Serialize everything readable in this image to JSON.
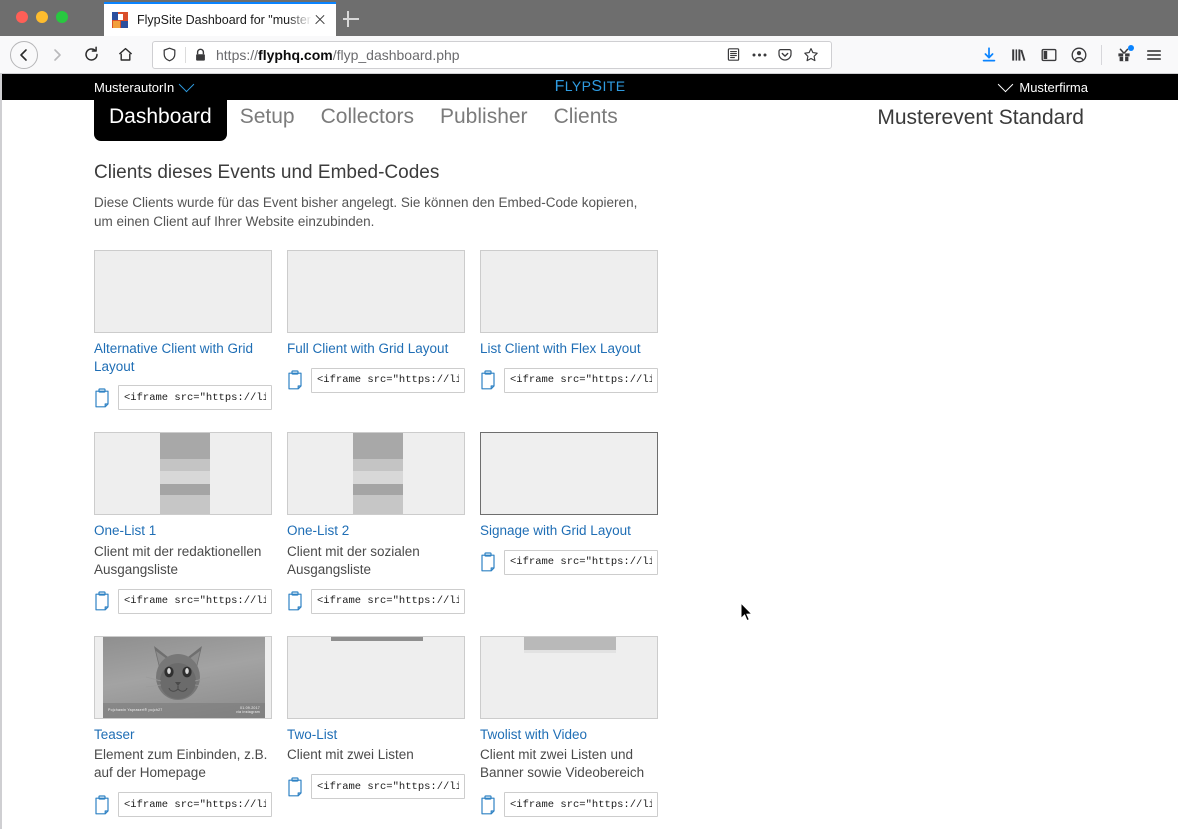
{
  "browser": {
    "tab": {
      "title": "FlypSite Dashboard for \"muster",
      "favicon_name": "flypsite-favicon",
      "close_label": "Close tab"
    },
    "new_tab_label": "New tab",
    "nav": {
      "back": "Back",
      "forward": "Forward",
      "reload": "Reload",
      "home": "Home"
    },
    "url": {
      "scheme": "https://",
      "host": "flyphq.com",
      "path": "/flyp_dashboard.php",
      "shield_icon": "shield-icon",
      "lock_icon": "lock-icon",
      "reader_icon": "reader-view-icon",
      "ellipsis_icon": "page-actions-icon",
      "pocket_icon": "pocket-icon",
      "star_icon": "bookmark-star-icon"
    },
    "toolbar": {
      "download_icon": "download-icon",
      "library_icon": "library-icon",
      "sidebar_icon": "sidebar-icon",
      "account_icon": "account-icon",
      "extensions_icon": "extensions-icon",
      "menu_icon": "hamburger-menu-icon"
    }
  },
  "appbar": {
    "user": "MusterautorIn",
    "brand_caps": "F",
    "brand_rest_1": "LYP",
    "brand_caps_2": "S",
    "brand_rest_2": "ITE",
    "brand_full": "FlypSite",
    "company": "Musterfirma"
  },
  "nav": {
    "tabs": [
      {
        "label": "Dashboard",
        "active": true
      },
      {
        "label": "Setup",
        "active": false
      },
      {
        "label": "Collectors",
        "active": false
      },
      {
        "label": "Publisher",
        "active": false
      },
      {
        "label": "Clients",
        "active": false
      }
    ],
    "event_title": "Musterevent Standard"
  },
  "page": {
    "heading": "Clients dieses Events und Embed-Codes",
    "subtext": "Diese Clients wurde für das Event bisher angelegt. Sie können den Embed-Code kopieren, um einen Client auf Ihrer Website einzubinden."
  },
  "embed_value": "<iframe src=\"https://live",
  "copy_icon_name": "clipboard-copy-icon",
  "cards": [
    {
      "title": "Alternative Client with Grid Layout",
      "desc": "",
      "thumb": "empty",
      "embed": "<iframe src=\"https://live"
    },
    {
      "title": "Full Client with Grid Layout",
      "desc": "",
      "thumb": "empty",
      "embed": "<iframe src=\"https://live"
    },
    {
      "title": "List Client with Flex Layout",
      "desc": "",
      "thumb": "empty",
      "embed": "<iframe src=\"https://live"
    },
    {
      "title": "One-List 1",
      "desc": "Client mit der redaktionellen Ausgangsliste",
      "thumb": "strip",
      "embed": "<iframe src=\"https://live"
    },
    {
      "title": "One-List 2",
      "desc": "Client mit der sozialen Ausgangsliste",
      "thumb": "strip",
      "embed": "<iframe src=\"https://live"
    },
    {
      "title": "Signage with Grid Layout",
      "desc": "",
      "thumb": "empty-strong",
      "embed": "<iframe src=\"https://live"
    },
    {
      "title": "Teaser",
      "desc": "Element zum Einbinden, z.B. auf der Homepage",
      "thumb": "photo",
      "embed": "<iframe src=\"https://live"
    },
    {
      "title": "Two-List",
      "desc": "Client mit zwei Listen",
      "thumb": "twolist",
      "embed": "<iframe src=\"https://live"
    },
    {
      "title": "Twolist with Video",
      "desc": "Client mit zwei Listen und Banner sowie Videobereich",
      "thumb": "twolist-video",
      "embed": "<iframe src=\"https://live"
    }
  ],
  "teaser_caption": {
    "left": "Pojchawin Yaprasert®  pojch27",
    "right_top": "01.09.2017",
    "right_bottom": "via instagram"
  },
  "colors": {
    "accent_blue": "#1f6eb5",
    "brand_blue": "#2f9be0",
    "appbar_black": "#000000",
    "tab_accent": "#0a84ff"
  }
}
